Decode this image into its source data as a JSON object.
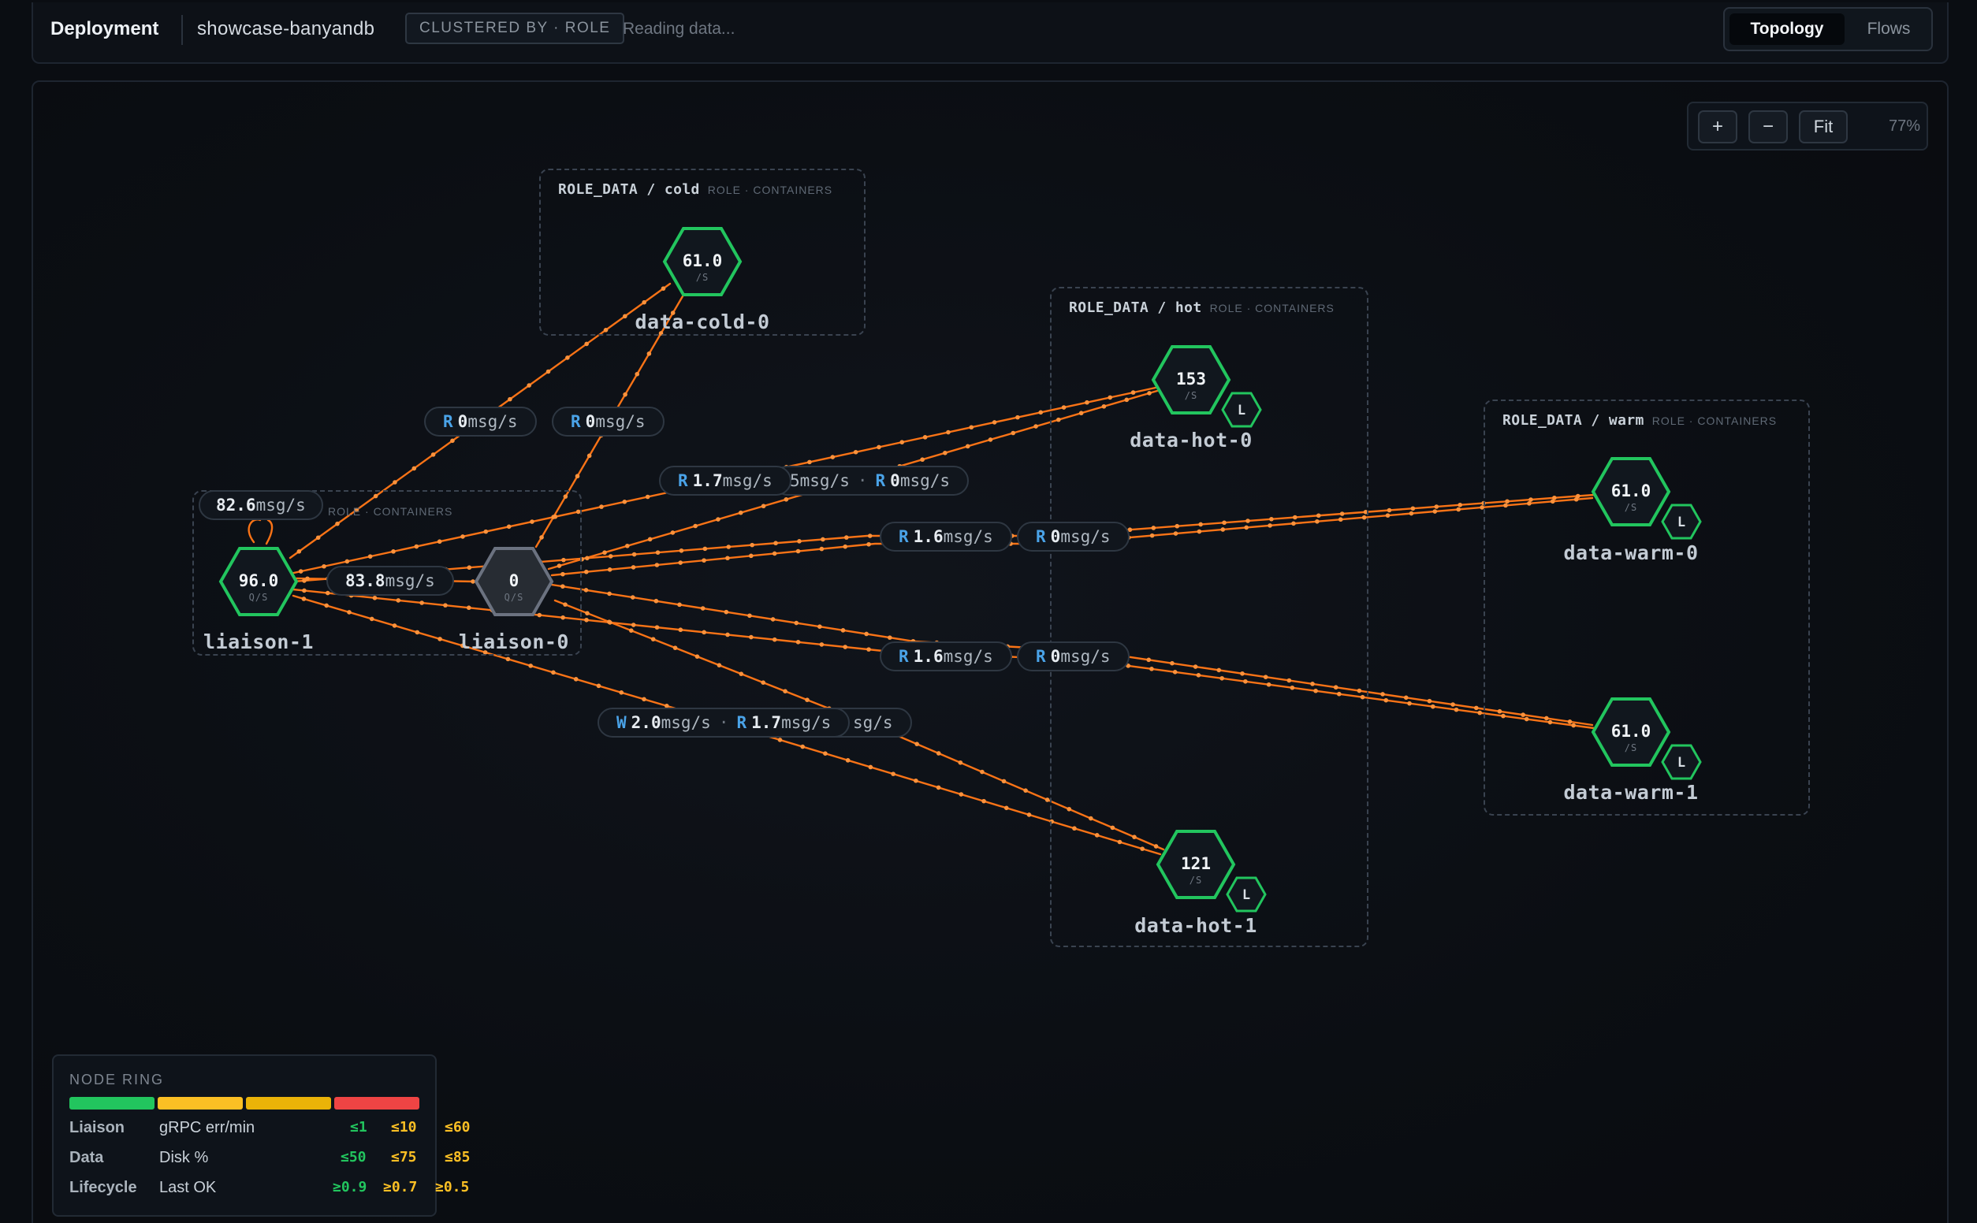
{
  "header": {
    "title": "Deployment",
    "deployment": "showcase-banyandb",
    "cluster_badge": "CLUSTERED BY · ROLE",
    "status": "Reading data...",
    "tabs": [
      {
        "label": "Topology",
        "active": true
      },
      {
        "label": "Flows",
        "active": false
      }
    ]
  },
  "zoom": {
    "plus": "+",
    "minus": "−",
    "fit": "Fit",
    "level": "77%"
  },
  "groups": {
    "cold": {
      "name": "ROLE_DATA / cold",
      "role": "ROLE · CONTAINERS"
    },
    "hot": {
      "name": "ROLE_DATA / hot",
      "role": "ROLE · CONTAINERS"
    },
    "warm": {
      "name": "ROLE_DATA / warm",
      "role": "ROLE · CONTAINERS"
    },
    "liaison": {
      "role": "ROLE · CONTAINERS"
    }
  },
  "nodes": {
    "data_cold_0": {
      "name": "data-cold-0",
      "value": "61.0",
      "unit": "/S"
    },
    "data_hot_0": {
      "name": "data-hot-0",
      "value": "153",
      "unit": "/S",
      "badge": "L"
    },
    "data_hot_1": {
      "name": "data-hot-1",
      "value": "121",
      "unit": "/S",
      "badge": "L"
    },
    "data_warm_0": {
      "name": "data-warm-0",
      "value": "61.0",
      "unit": "/S",
      "badge": "L"
    },
    "data_warm_1": {
      "name": "data-warm-1",
      "value": "61.0",
      "unit": "/S",
      "badge": "L"
    },
    "liaison_1": {
      "name": "liaison-1",
      "value": "96.0",
      "unit": "Q/S"
    },
    "liaison_0": {
      "name": "liaison-0",
      "value": "0",
      "unit": "Q/S"
    }
  },
  "edge_labels": {
    "self_loop": {
      "value": "82.6",
      "unit": "msg/s"
    },
    "liaison_link": {
      "value": "83.8",
      "unit": "msg/s"
    },
    "cold_a": {
      "kind": "R",
      "value": "0",
      "unit": "msg/s"
    },
    "cold_b": {
      "kind": "R",
      "value": "0",
      "unit": "msg/s"
    },
    "hot0": {
      "kind": "R",
      "value": "1.7",
      "unit": "msg/s",
      "partial": "5msg/s",
      "kind2": "R",
      "value2": "0",
      "unit2": "msg/s"
    },
    "warm0_a": {
      "kind": "R",
      "value": "1.6",
      "unit": "msg/s"
    },
    "warm0_b": {
      "kind": "R",
      "value": "0",
      "unit": "msg/s"
    },
    "warm1_a": {
      "kind": "R",
      "value": "1.6",
      "unit": "msg/s"
    },
    "warm1_b": {
      "kind": "R",
      "value": "0",
      "unit": "msg/s"
    },
    "hot1": {
      "kind": "W",
      "value": "2.0",
      "unit": "msg/s",
      "kind2": "R",
      "value2": "1.7",
      "unit2": "msg/s",
      "partial": "sg/s"
    }
  },
  "legend": {
    "title": "NODE RING",
    "ring_colors": [
      "#22c55e",
      "#fbbf24",
      "#eab308",
      "#ef4444"
    ],
    "rows": [
      {
        "category": "Liaison",
        "metric": "gRPC err/min",
        "t1": "≤1",
        "t2": "≤10",
        "t3": "≤60"
      },
      {
        "category": "Data",
        "metric": "Disk %",
        "t1": "≤50",
        "t2": "≤75",
        "t3": "≤85"
      },
      {
        "category": "Lifecycle",
        "metric": "Last OK",
        "t1": "≥0.9",
        "t2": "≥0.7",
        "t3": "≥0.5"
      }
    ]
  },
  "colors": {
    "edge": "#f97316",
    "healthy": "#22c55e",
    "idle": "#6b7280",
    "accent_key": "#4aa3e8",
    "threshold_green": "#22c55e",
    "threshold_yellow": "#fbbf24"
  }
}
